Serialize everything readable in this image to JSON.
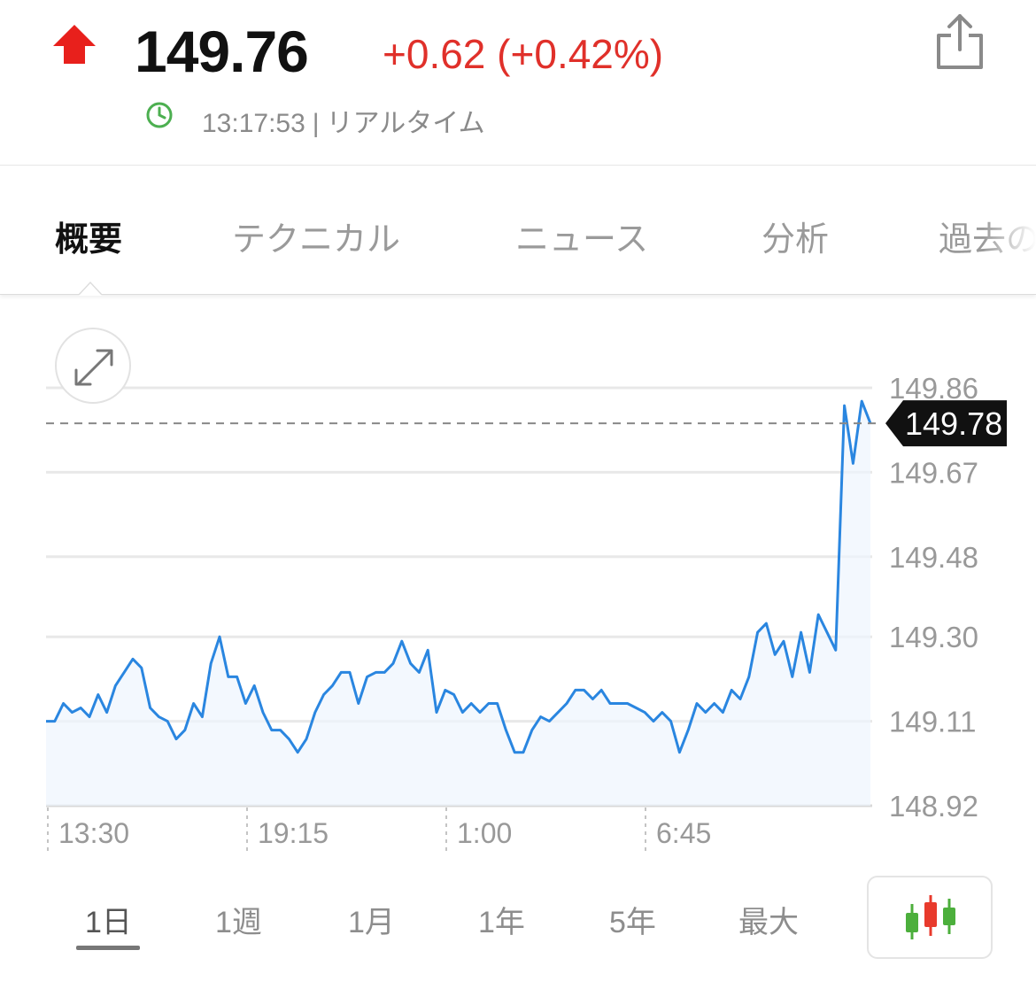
{
  "quote": {
    "price": "149.76",
    "change": "+0.62 (+0.42%)",
    "time": "13:17:53",
    "separator": "|",
    "status": "リアルタイム"
  },
  "tabs": [
    "概要",
    "テクニカル",
    "ニュース",
    "分析",
    "過去の"
  ],
  "range_tabs": [
    "1日",
    "1週",
    "1月",
    "1年",
    "5年",
    "最大"
  ],
  "colors": {
    "up": "#e8201c",
    "change_text": "#e0302a",
    "line": "#2a86e0",
    "clock": "#4caf50",
    "candle_green": "#4caf3c",
    "candle_red": "#e83a2c"
  },
  "icons": {
    "direction": "up-arrow-icon",
    "clock": "clock-icon",
    "share": "share-icon",
    "expand": "expand-icon",
    "chart_type": "candlestick-icon"
  },
  "chart_data": {
    "type": "line",
    "x_ticks": [
      "13:30",
      "19:15",
      "1:00",
      "6:45"
    ],
    "y_ticks": [
      149.86,
      149.67,
      149.48,
      149.3,
      149.11,
      148.92
    ],
    "ylim": [
      148.92,
      149.86
    ],
    "current_value": "149.78",
    "current_marker": 149.78,
    "grid": true,
    "values": [
      149.11,
      149.11,
      149.15,
      149.13,
      149.14,
      149.12,
      149.17,
      149.13,
      149.19,
      149.22,
      149.25,
      149.23,
      149.14,
      149.12,
      149.11,
      149.07,
      149.09,
      149.15,
      149.12,
      149.24,
      149.3,
      149.21,
      149.21,
      149.15,
      149.19,
      149.13,
      149.09,
      149.09,
      149.07,
      149.04,
      149.07,
      149.13,
      149.17,
      149.19,
      149.22,
      149.22,
      149.15,
      149.21,
      149.22,
      149.22,
      149.24,
      149.29,
      149.24,
      149.22,
      149.27,
      149.13,
      149.18,
      149.17,
      149.13,
      149.15,
      149.13,
      149.15,
      149.15,
      149.09,
      149.04,
      149.04,
      149.09,
      149.12,
      149.11,
      149.13,
      149.15,
      149.18,
      149.18,
      149.16,
      149.18,
      149.15,
      149.15,
      149.15,
      149.14,
      149.13,
      149.11,
      149.13,
      149.11,
      149.04,
      149.09,
      149.15,
      149.13,
      149.15,
      149.13,
      149.18,
      149.16,
      149.21,
      149.31,
      149.33,
      149.26,
      149.29,
      149.21,
      149.31,
      149.22,
      149.35,
      149.31,
      149.27,
      149.82,
      149.69,
      149.83,
      149.78
    ]
  }
}
